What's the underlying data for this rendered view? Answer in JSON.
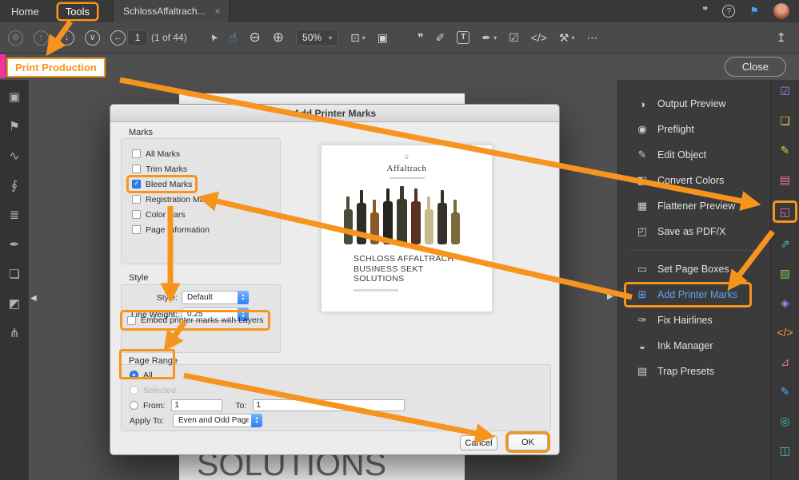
{
  "colors": {
    "annotation_orange": "#f7941d",
    "active_blue": "#5ea1f0",
    "macos_blue": "#2f7cf6"
  },
  "tabbar": {
    "home": "Home",
    "tools": "Tools",
    "document_tab": "SchlossAffaltrach...",
    "tab_close_glyph": "×",
    "chat_glyph": "❞",
    "help_glyph": "?",
    "bell_glyph": "⚑"
  },
  "toolbar": {
    "page_value": "1",
    "page_count": "(1 of 44)",
    "left_icons": [
      {
        "name": "save-icon",
        "glyph": "⊜",
        "cls": "circle disabled"
      },
      {
        "name": "print-icon",
        "glyph": "↑",
        "cls": "circle disabled"
      },
      {
        "name": "page-down-icon",
        "glyph": "↓",
        "cls": "circle"
      },
      {
        "name": "last-page-icon",
        "glyph": "∨",
        "cls": "circle"
      },
      {
        "name": "previous-view-icon",
        "glyph": "←",
        "cls": "circle"
      }
    ],
    "mid_icons": [
      {
        "name": "select-tool-icon",
        "glyph": "➤",
        "cls": "cursor"
      },
      {
        "name": "hand-tool-icon",
        "glyph": "☝",
        "cls": "active-tool",
        "active": true
      },
      {
        "name": "zoom-out-icon",
        "glyph": "⊖",
        "cls": "big"
      },
      {
        "name": "zoom-in-icon",
        "glyph": "⊕",
        "cls": "big"
      },
      {
        "name": "zoom-level-dropdown",
        "glyph": "50%",
        "caret": "▾",
        "cls": "zoombox"
      },
      {
        "name": "marquee-zoom-icon",
        "glyph": "⊡",
        "caret": "▾"
      },
      {
        "name": "page-display-icon",
        "glyph": "▣"
      },
      {
        "name": "comment-icon",
        "glyph": "❞",
        "cls": "gap"
      },
      {
        "name": "highlight-icon",
        "glyph": "✐"
      },
      {
        "name": "text-box-icon",
        "glyph": "T",
        "cls": "sq"
      },
      {
        "name": "sign-icon",
        "glyph": "✒",
        "caret": "▾"
      },
      {
        "name": "certificates-icon",
        "glyph": "☑"
      },
      {
        "name": "code-icon",
        "glyph": "</>"
      },
      {
        "name": "tools-case-icon",
        "glyph": "⚒",
        "caret": "▾"
      },
      {
        "name": "more-tools-icon",
        "glyph": "⋯"
      }
    ],
    "share_glyph": "↥"
  },
  "subheader": {
    "print_production_label": "Print Production",
    "close_label": "Close"
  },
  "sidebar": {
    "icons": [
      {
        "name": "page-thumbnails-icon",
        "glyph": "▣"
      },
      {
        "name": "bookmarks-icon",
        "glyph": "⚑"
      },
      {
        "name": "signatures-icon",
        "glyph": "∿"
      },
      {
        "name": "attachments-icon",
        "glyph": "∮"
      },
      {
        "name": "layers-icon",
        "glyph": "≣"
      },
      {
        "name": "fill-sign-icon",
        "glyph": "✒"
      },
      {
        "name": "destinations-icon",
        "glyph": "❏"
      },
      {
        "name": "tags-icon",
        "glyph": "◩"
      },
      {
        "name": "order-icon",
        "glyph": "⋔"
      }
    ]
  },
  "content": {
    "background_page_text": "SOLUTIONS"
  },
  "right_panel": {
    "items": [
      {
        "name": "panel-item-output-preview",
        "icon": "◑",
        "label": "Output Preview"
      },
      {
        "name": "panel-item-preflight",
        "icon": "◉",
        "label": "Preflight"
      },
      {
        "name": "panel-item-edit-object",
        "icon": "✎",
        "label": "Edit Object"
      },
      {
        "name": "panel-item-convert-colors",
        "icon": "◧",
        "label": "Convert Colors"
      },
      {
        "name": "panel-item-flattener-preview",
        "icon": "▦",
        "label": "Flattener Preview"
      },
      {
        "name": "panel-item-save-as-pdfx",
        "icon": "◰",
        "label": "Save as PDF/X"
      },
      {
        "divider": true
      },
      {
        "name": "panel-item-set-page-boxes",
        "icon": "▭",
        "label": "Set Page Boxes"
      },
      {
        "name": "panel-item-add-printer-marks",
        "icon": "⊞",
        "label": "Add Printer Marks",
        "active": true
      },
      {
        "name": "panel-item-fix-hairlines",
        "icon": "✑",
        "label": "Fix Hairlines"
      },
      {
        "name": "panel-item-ink-manager",
        "icon": "◒",
        "label": "Ink Manager"
      },
      {
        "name": "panel-item-trap-presets",
        "icon": "▤",
        "label": "Trap Presets"
      }
    ]
  },
  "right_strip": {
    "icons": [
      {
        "name": "prepare-form-icon",
        "glyph": "☑",
        "color": "#a884f3"
      },
      {
        "name": "comment-tool-icon",
        "glyph": "❏",
        "color": "#e3c84e"
      },
      {
        "name": "edit-pdf-icon",
        "glyph": "✎",
        "color": "#cdd34f"
      },
      {
        "name": "organize-pages-icon",
        "glyph": "▤",
        "color": "#ef6faa"
      },
      {
        "name": "print-production-icon",
        "glyph": "◱",
        "color": "#ef6faa",
        "boxed": true
      },
      {
        "name": "export-pdf-icon",
        "glyph": "⇗",
        "color": "#45c3cb"
      },
      {
        "name": "scan-ocr-icon",
        "glyph": "▧",
        "color": "#7ec64f"
      },
      {
        "name": "protect-icon",
        "glyph": "◈",
        "color": "#a884f3"
      },
      {
        "name": "rich-media-icon",
        "glyph": "</>",
        "color": "#e8a33d"
      },
      {
        "name": "measure-icon",
        "glyph": "⊿",
        "color": "#ef6faa"
      },
      {
        "name": "draw-icon",
        "glyph": "✎",
        "color": "#5aa7f0"
      },
      {
        "name": "compare-files-icon",
        "glyph": "◎",
        "color": "#45c3cb"
      },
      {
        "name": "threed-tool-icon",
        "glyph": "◫",
        "color": "#45c3cb"
      }
    ]
  },
  "dialog": {
    "title": "Add Printer Marks",
    "marks_section_label": "Marks",
    "marks": [
      {
        "label": "All Marks"
      },
      {
        "label": "Trim Marks"
      },
      {
        "label": "Bleed Marks",
        "checked": true,
        "boxed": true
      },
      {
        "label": "Registration Marks"
      },
      {
        "label": "Color Bars"
      },
      {
        "label": "Page Information"
      }
    ],
    "style_section_label": "Style",
    "style_label": "Style:",
    "style_value": "Default",
    "line_weight_label": "Line Weight:",
    "line_weight_value": "0.25",
    "embed_label": "Embed printer marks with Layers",
    "page_range_label": "Page Range",
    "all_label": "All",
    "selected_label": "Selected",
    "from_label": "From:",
    "to_label": "To:",
    "from_value": "1",
    "to_value": "1",
    "apply_to_label": "Apply To:",
    "apply_to_value": "Even and Odd Pages",
    "cancel_label": "Cancel",
    "ok_label": "OK",
    "preview": {
      "brand_crown": "♕",
      "brand": "Affaltrach",
      "title_line1": "SCHLOSS AFFALTRACH",
      "title_line2": "BUSINESS SEKT",
      "title_line3": "SOLUTIONS"
    }
  }
}
